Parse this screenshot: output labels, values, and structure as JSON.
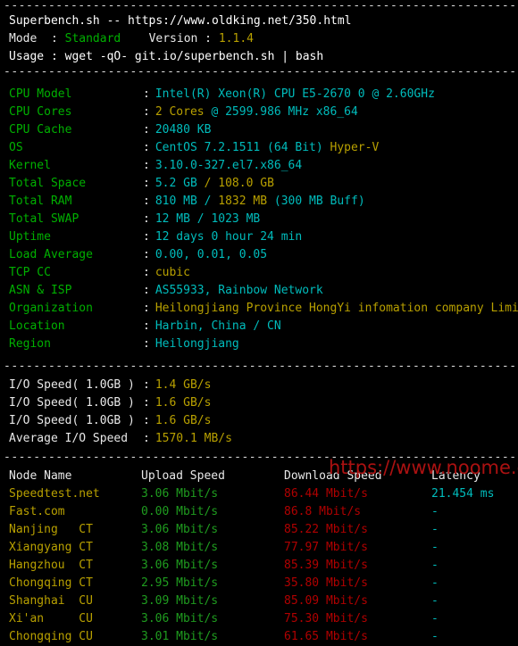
{
  "terminal": {
    "background": "#000000",
    "separator": "-------------------------------------------------------------------------",
    "colors": {
      "white": "#e8e8e8",
      "green": "#00b000",
      "cyan": "#00bcbc",
      "yellow": "#b8a000",
      "red": "#b00000"
    }
  },
  "header": {
    "title_line": "Superbench.sh -- https://www.oldking.net/350.html",
    "mode_label": "Mode  : ",
    "mode_value": "Standard",
    "version_label": "Version : ",
    "version_value": "1.1.4",
    "usage_line": "Usage : wget -qO- git.io/superbench.sh | bash"
  },
  "sysinfo": [
    {
      "label": "CPU Model",
      "parts": [
        {
          "text": "Intel(R) Xeon(R) CPU E5-2670 0 @ 2.60GHz",
          "color": "cyan"
        }
      ]
    },
    {
      "label": "CPU Cores",
      "parts": [
        {
          "text": "2 Cores",
          "color": "yellow"
        },
        {
          "text": " @ 2599.986 MHz x86_64",
          "color": "cyan"
        }
      ]
    },
    {
      "label": "CPU Cache",
      "parts": [
        {
          "text": "20480 KB",
          "color": "cyan"
        }
      ]
    },
    {
      "label": "OS",
      "parts": [
        {
          "text": "CentOS 7.2.1511 (64 Bit) ",
          "color": "cyan"
        },
        {
          "text": "Hyper-V",
          "color": "yellow"
        }
      ]
    },
    {
      "label": "Kernel",
      "parts": [
        {
          "text": "3.10.0-327.el7.x86_64",
          "color": "cyan"
        }
      ]
    },
    {
      "label": "Total Space",
      "parts": [
        {
          "text": "5.2 GB ",
          "color": "cyan"
        },
        {
          "text": "/ 108.0 GB",
          "color": "yellow"
        }
      ]
    },
    {
      "label": "Total RAM",
      "parts": [
        {
          "text": "810 MB / ",
          "color": "cyan"
        },
        {
          "text": "1832 MB ",
          "color": "yellow"
        },
        {
          "text": "(300 MB Buff)",
          "color": "cyan"
        }
      ]
    },
    {
      "label": "Total SWAP",
      "parts": [
        {
          "text": "12 MB / 1023 MB",
          "color": "cyan"
        }
      ]
    },
    {
      "label": "Uptime",
      "parts": [
        {
          "text": "12 days 0 hour 24 min",
          "color": "cyan"
        }
      ]
    },
    {
      "label": "Load Average",
      "parts": [
        {
          "text": "0.00, 0.01, 0.05",
          "color": "cyan"
        }
      ]
    },
    {
      "label": "TCP CC",
      "parts": [
        {
          "text": "cubic",
          "color": "yellow"
        }
      ]
    },
    {
      "label": "ASN & ISP",
      "parts": [
        {
          "text": "AS55933, Rainbow Network",
          "color": "cyan"
        }
      ]
    },
    {
      "label": "Organization",
      "parts": [
        {
          "text": "Heilongjiang Province HongYi infomation company Limited",
          "color": "yellow"
        }
      ]
    },
    {
      "label": "Location",
      "parts": [
        {
          "text": "Harbin, China / CN",
          "color": "cyan"
        }
      ]
    },
    {
      "label": "Region",
      "parts": [
        {
          "text": "Heilongjiang",
          "color": "cyan"
        }
      ]
    }
  ],
  "io": [
    {
      "label": "I/O Speed( 1.0GB )",
      "value": "1.4 GB/s"
    },
    {
      "label": "I/O Speed( 1.0GB )",
      "value": "1.6 GB/s"
    },
    {
      "label": "I/O Speed( 1.0GB )",
      "value": "1.6 GB/s"
    },
    {
      "label": "Average I/O Speed",
      "value": "1570.1 MB/s"
    }
  ],
  "speedtest": {
    "headers": {
      "node": "Node Name",
      "upload": "Upload Speed",
      "download": "Download Speed",
      "latency": "Latency"
    },
    "rows": [
      {
        "node": "Speedtest.net",
        "upload": "3.06 Mbit/s",
        "download": "86.44 Mbit/s",
        "latency": "21.454 ms"
      },
      {
        "node": "Fast.com",
        "upload": "0.00 Mbit/s",
        "download": "86.8 Mbit/s",
        "latency": "-"
      },
      {
        "node": "Nanjing   CT",
        "upload": "3.06 Mbit/s",
        "download": "85.22 Mbit/s",
        "latency": "-"
      },
      {
        "node": "Xiangyang CT",
        "upload": "3.08 Mbit/s",
        "download": "77.97 Mbit/s",
        "latency": "-"
      },
      {
        "node": "Hangzhou  CT",
        "upload": "3.06 Mbit/s",
        "download": "85.39 Mbit/s",
        "latency": "-"
      },
      {
        "node": "Chongqing CT",
        "upload": "2.95 Mbit/s",
        "download": "35.80 Mbit/s",
        "latency": "-"
      },
      {
        "node": "Shanghai  CU",
        "upload": "3.09 Mbit/s",
        "download": "85.09 Mbit/s",
        "latency": "-"
      },
      {
        "node": "Xi'an     CU",
        "upload": "3.06 Mbit/s",
        "download": "75.30 Mbit/s",
        "latency": "-"
      },
      {
        "node": "Chongqing CU",
        "upload": "3.01 Mbit/s",
        "download": "61.65 Mbit/s",
        "latency": "-"
      }
    ]
  },
  "watermark": {
    "text": "https://www.noome.cn",
    "color": "#aa1111"
  }
}
